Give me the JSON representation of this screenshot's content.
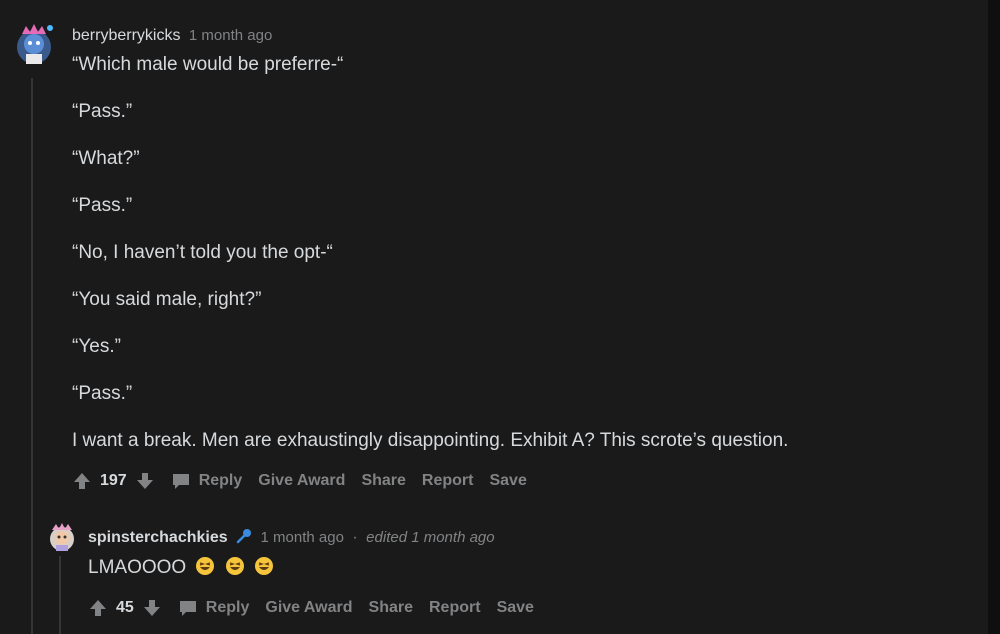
{
  "comment1": {
    "username": "berryberrykicks",
    "timestamp": "1 month ago",
    "lines": [
      "“Which male would be preferre-“",
      "“Pass.”",
      "“What?”",
      "“Pass.”",
      "“No, I haven’t told you the opt-“",
      "“You said male, right?”",
      "“Yes.”",
      "“Pass.”",
      "I want a break. Men are exhaustingly disappointing. Exhibit A? This scrote’s question."
    ],
    "votes": "197",
    "actions": {
      "reply": "Reply",
      "give_award": "Give Award",
      "share": "Share",
      "report": "Report",
      "save": "Save"
    }
  },
  "comment2": {
    "username": "spinsterchachkies",
    "timestamp": "1 month ago",
    "separator": "·",
    "edited": "edited 1 month ago",
    "text": "LMAOOOO",
    "votes": "45",
    "actions": {
      "reply": "Reply",
      "give_award": "Give Award",
      "share": "Share",
      "report": "Report",
      "save": "Save"
    }
  },
  "colors": {
    "background": "#1a1a1b",
    "text": "#d7dadc",
    "muted": "#818384",
    "thread": "#343536"
  }
}
